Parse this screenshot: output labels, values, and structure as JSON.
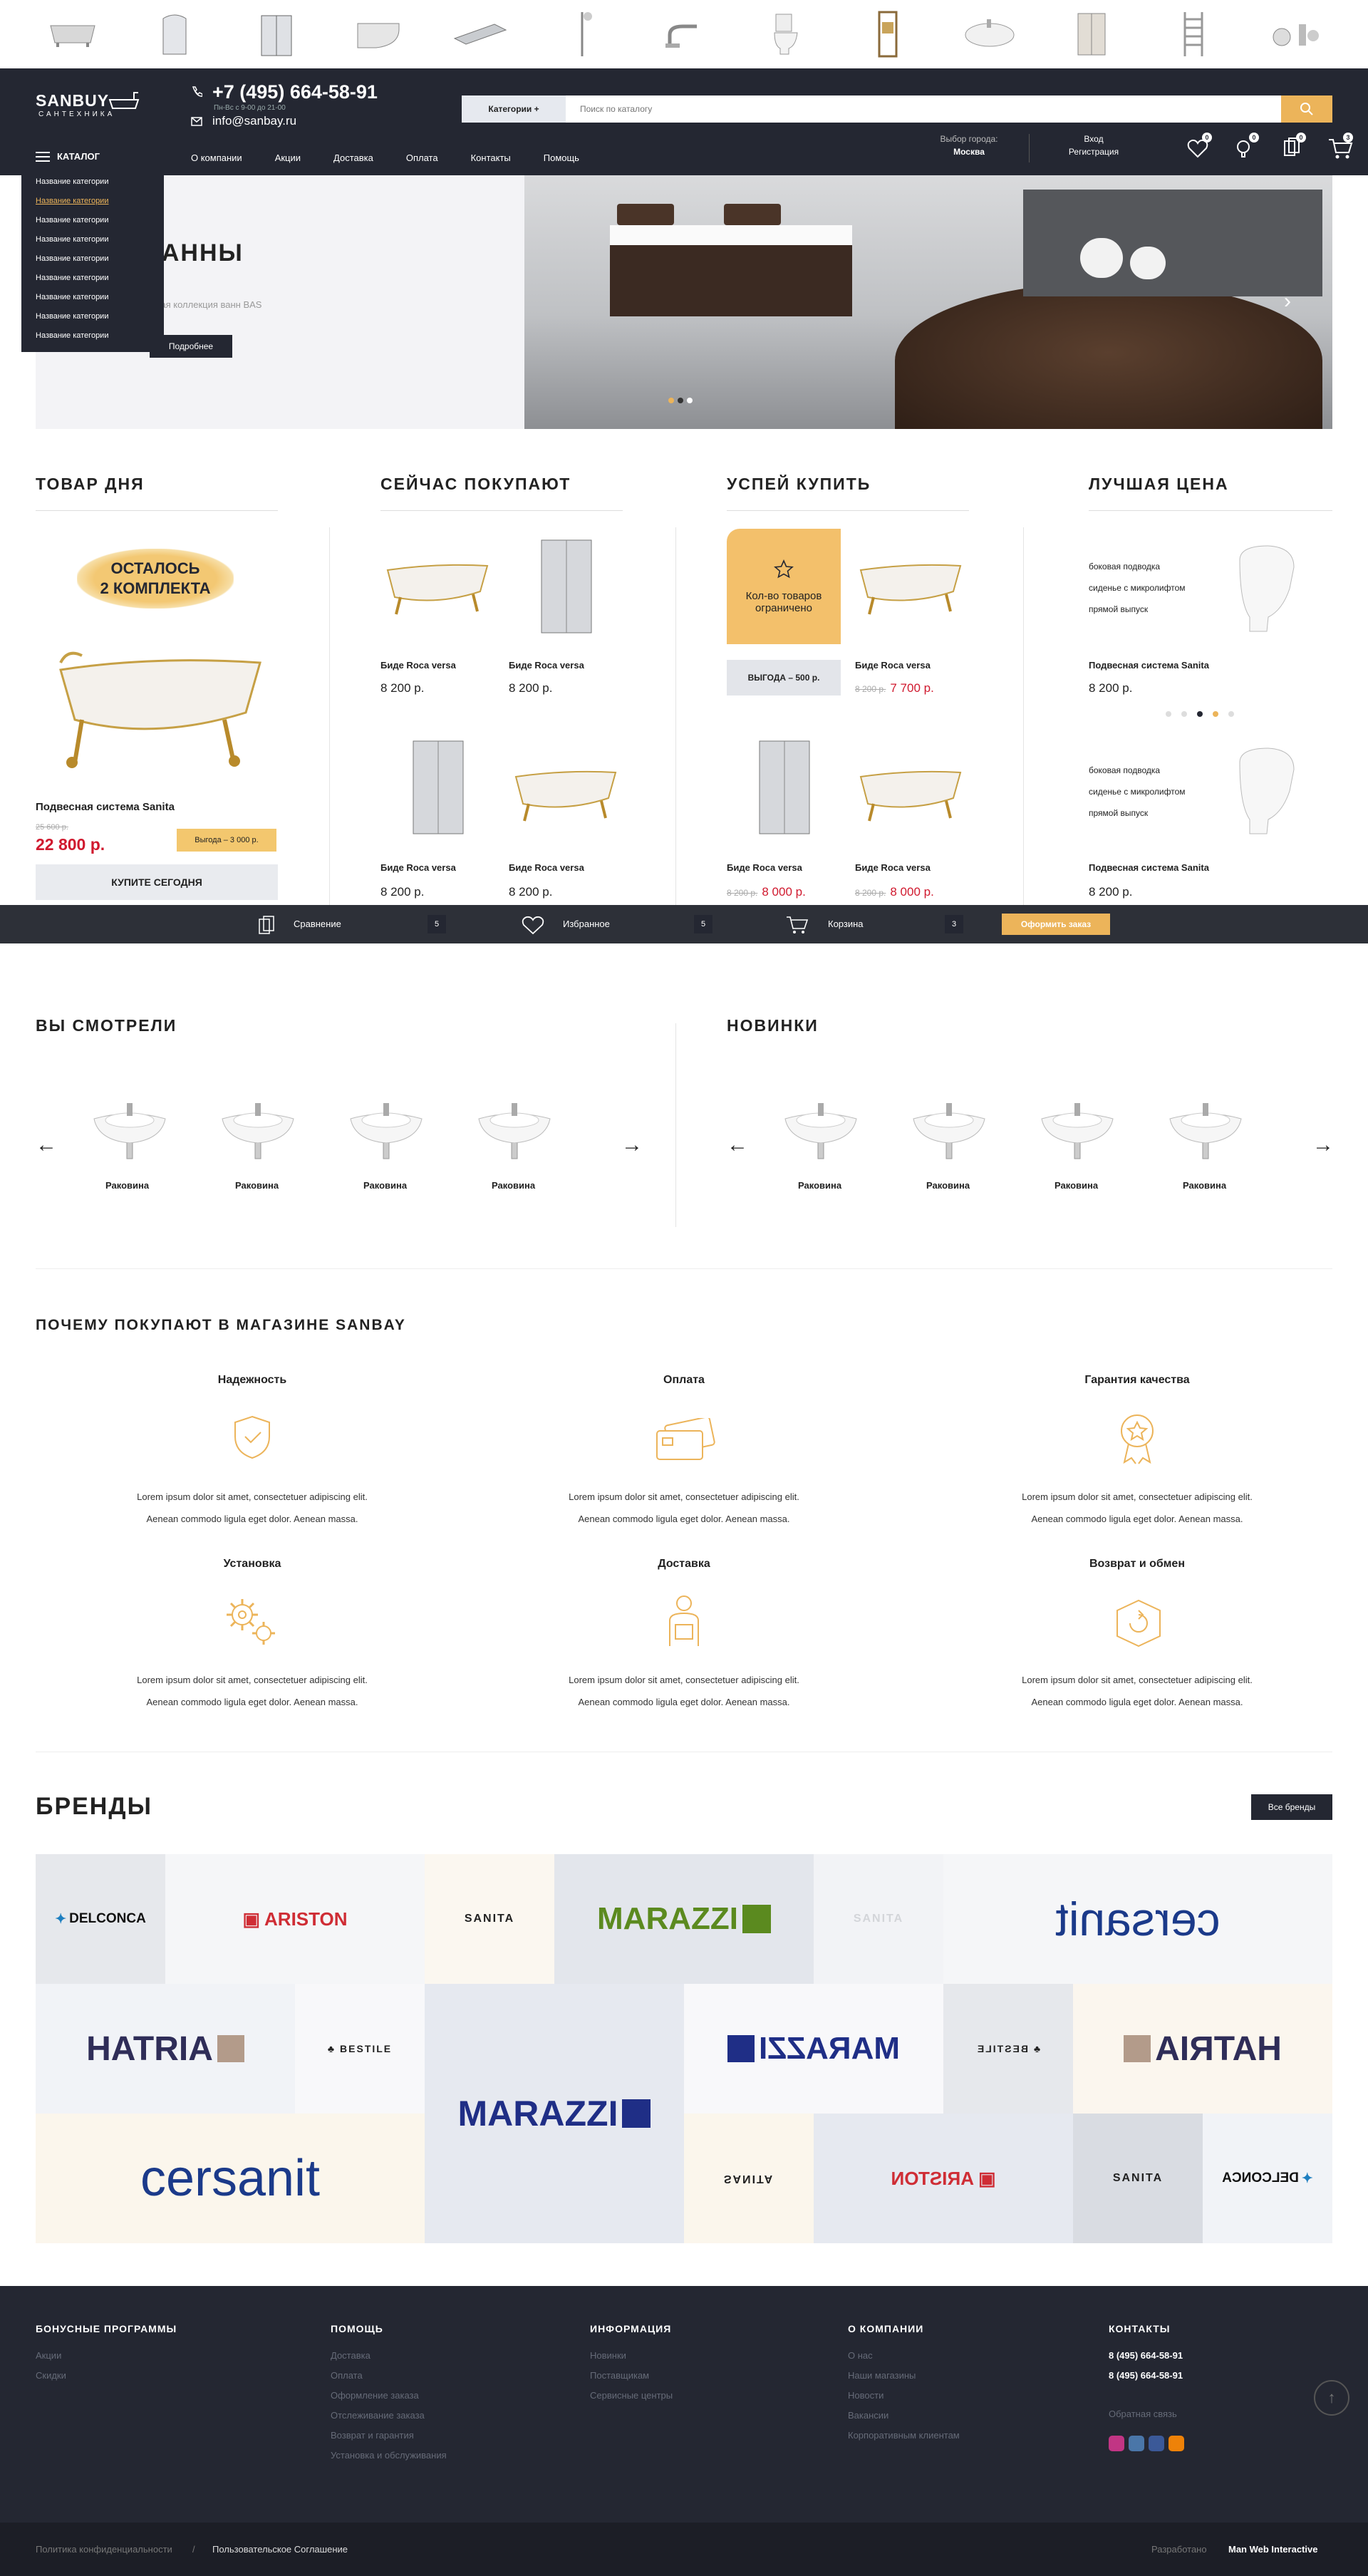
{
  "catbar": [
    "bathtub-icon",
    "shower-cabin-icon",
    "shower-enclosure-icon",
    "corner-bath-icon",
    "shower-drain-icon",
    "shower-set-icon",
    "faucet-icon",
    "toilet-icon",
    "installation-frame-icon",
    "sink-icon",
    "cabinet-icon",
    "towel-rail-icon",
    "accessories-icon"
  ],
  "header": {
    "logo_main": "SANBUY",
    "logo_sub": "САНТЕХНИКА",
    "phone": "+7 (495) 664-58-91",
    "hours": "Пн-Вс с 9-00 до 21-00",
    "email": "info@sanbay.ru",
    "search_category": "Категории",
    "search_placeholder": "Поиск по каталогу",
    "catalog": "КАТАЛОГ",
    "menu": [
      "О компании",
      "Акции",
      "Доставка",
      "Оплата",
      "Контакты",
      "Помощь"
    ],
    "city_label": "Выбор города:",
    "city_value": "Москва",
    "login": "Вход",
    "register": "Регистрация",
    "badges": [
      "0",
      "0",
      "0",
      "3"
    ]
  },
  "dropdown": [
    "Название категории",
    "Название категории",
    "Название категории",
    "Название категории",
    "Название категории",
    "Название категории",
    "Название категории",
    "Название категории",
    "Название категории"
  ],
  "hero": {
    "title": "ВАННЫ",
    "subtitle": "Новая коллекция ванн BAS",
    "button": "Подробнее"
  },
  "deal": {
    "title": "ТОВАР ДНЯ",
    "stamp": [
      "ОСТАЛОСЬ",
      "2 КОМПЛЕКТА"
    ],
    "name": "Подвесная система Sanita",
    "old_price": "25 600 р.",
    "price": "22 800 р.",
    "benefit": "Выгода – 3 000 р.",
    "buy": "КУПИТЕ СЕГОДНЯ"
  },
  "now_buying": {
    "title": "СЕЙЧАС ПОКУПАЮТ",
    "items": [
      {
        "name": "Биде Roca versa",
        "price": "8 200 р."
      },
      {
        "name": "Биде Roca versa",
        "price": "8 200 р."
      },
      {
        "name": "Биде Roca versa",
        "price": "8 200 р."
      },
      {
        "name": "Биде Roca versa",
        "price": "8 200 р."
      }
    ]
  },
  "hurry": {
    "title": "УСПЕЙ КУПИТЬ",
    "limited": "Кол-во товаров ограничено",
    "benefit": "ВЫГОДА – 500 р.",
    "items": [
      {
        "name": "Биде Roca versa",
        "old": "8 200 р.",
        "price": "7 700 р."
      },
      {
        "name": "Биде Roca versa",
        "old": "8 200 р.",
        "price": "8 000 р."
      },
      {
        "name": "Биде Roca versa",
        "old": "8 200 р.",
        "price": "8 000 р."
      }
    ]
  },
  "best": {
    "title": "ЛУЧШАЯ ЦЕНА",
    "features": [
      "боковая подводка",
      "сиденье с микролифтом",
      "прямой выпуск"
    ],
    "items": [
      {
        "name": "Подвесная система  Sanita",
        "price": "8 200 р."
      },
      {
        "name": "Подвесная система  Sanita",
        "price": "8 200 р."
      }
    ]
  },
  "sticky": {
    "compare": "Сравнение",
    "compare_count": "5",
    "favorites": "Избранное",
    "favorites_count": "5",
    "cart": "Корзина",
    "cart_count": "3",
    "checkout": "Оформить заказ"
  },
  "viewed": {
    "title": "ВЫ СМОТРЕЛИ",
    "items": [
      "Раковина",
      "Раковина",
      "Раковина",
      "Раковина"
    ]
  },
  "newest": {
    "title": "НОВИНКИ",
    "items": [
      "Раковина",
      "Раковина",
      "Раковина",
      "Раковина"
    ]
  },
  "why": {
    "title": "ПОЧЕМУ ПОКУПАЮТ В МАГАЗИНЕ SANBAY",
    "line1": "Lorem ipsum dolor sit amet, consectetuer adipiscing elit.",
    "line2": "Aenean commodo ligula eget dolor. Aenean massa.",
    "items": [
      "Надежность",
      "Оплата",
      "Гарантия качества",
      "Установка",
      "Доставка",
      "Возврат и обмен"
    ]
  },
  "brands": {
    "title": "БРЕНДЫ",
    "all": "Все бренды",
    "names": {
      "delconca": "DELCONCA",
      "ariston": "ARISTON",
      "sanita": "SANITA",
      "marazzi": "MARAZZI",
      "cersanit": "cersanit",
      "hatria": "HATRIA",
      "bestile": "BESTILE"
    }
  },
  "footer": {
    "cols": [
      {
        "title": "БОНУСНЫЕ ПРОГРАММЫ",
        "links": [
          "Акции",
          "Скидки"
        ]
      },
      {
        "title": "ПОМОЩЬ",
        "links": [
          "Доставка",
          "Оплата",
          "Оформление заказа",
          "Отслеживание заказа",
          "Возврат и гарантия",
          "Установка и обслуживания"
        ]
      },
      {
        "title": "ИНФОРМАЦИЯ",
        "links": [
          "Новинки",
          "Поставщикам",
          "Сервисные центры"
        ]
      },
      {
        "title": "О КОМПАНИИ",
        "links": [
          "О нас",
          "Наши магазины",
          "Новости",
          "Вакансии",
          "Корпоративным клиентам"
        ]
      }
    ],
    "contacts_title": "КОНТАКТЫ",
    "phone1": "8 (495) 664-58-91",
    "phone2": "8 (495) 664-58-91",
    "feedback": "Обратная связь",
    "privacy": "Политика конфиденциальности",
    "agreement": "Пользовательское Соглашение",
    "dev_label": "Разработано",
    "dev_name": "Man Web Interactive"
  }
}
